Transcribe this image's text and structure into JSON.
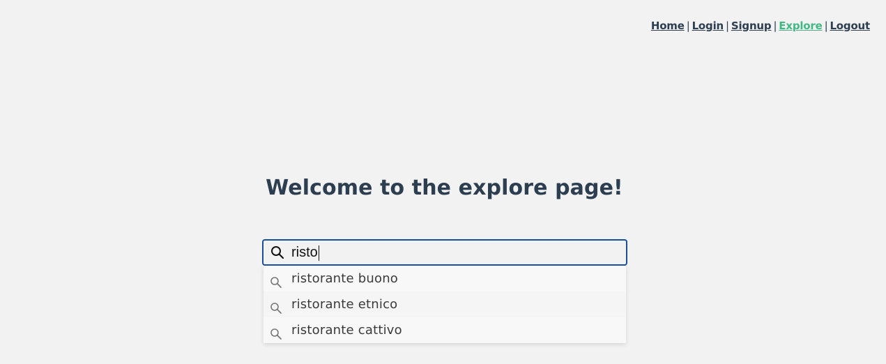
{
  "nav": {
    "links": [
      {
        "label": "Home"
      },
      {
        "label": "Login"
      },
      {
        "label": "Signup"
      },
      {
        "label": "Explore"
      },
      {
        "label": "Logout"
      }
    ],
    "separator": "|",
    "active_color": "#42b983"
  },
  "page": {
    "title": "Welcome to the explore page!"
  },
  "search": {
    "value": "risto",
    "icon": "search-icon",
    "focus_color": "#1a4fa0",
    "suggestions": [
      {
        "label": "ristorante buono"
      },
      {
        "label": "ristorante etnico"
      },
      {
        "label": "ristorante cattivo"
      }
    ]
  }
}
